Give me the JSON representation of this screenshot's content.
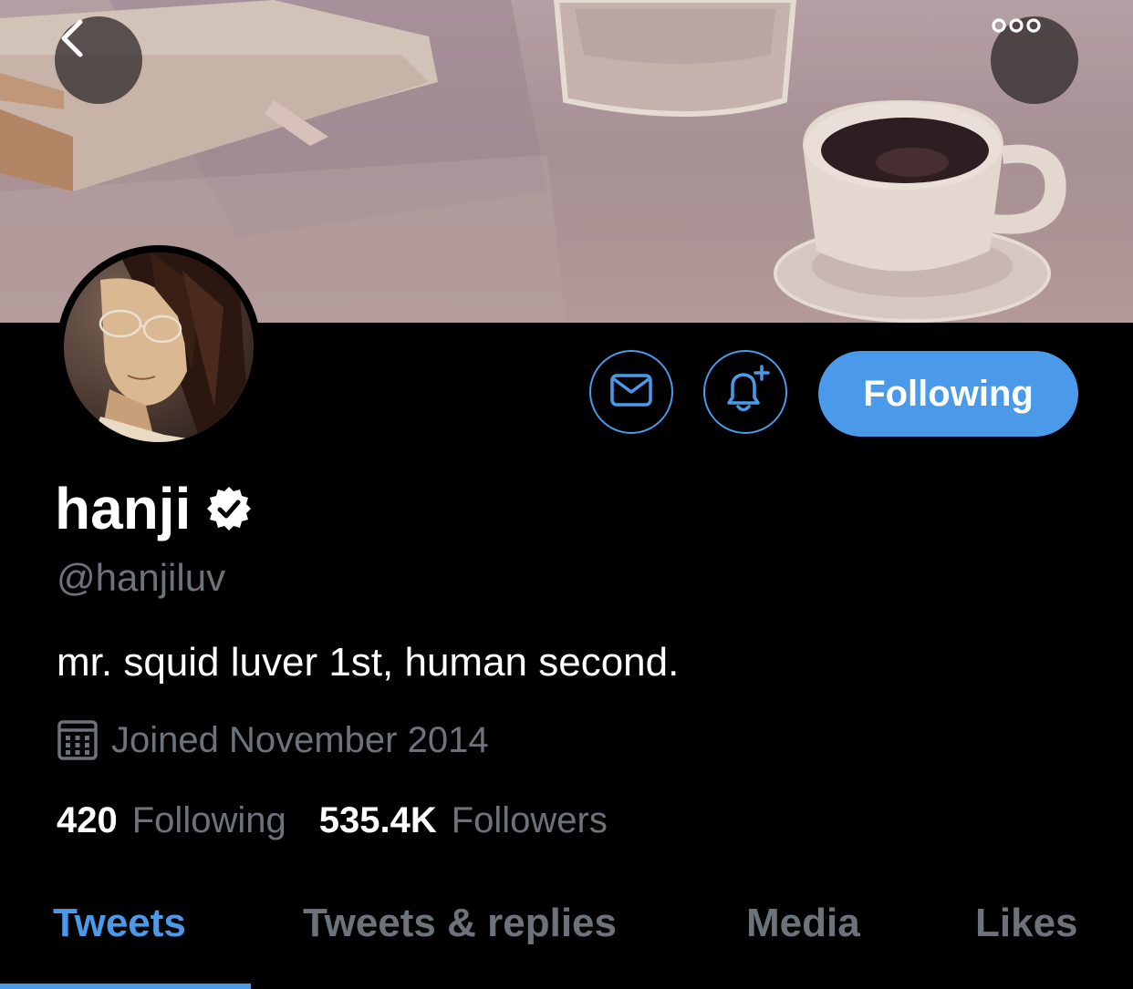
{
  "header": {
    "back_icon": "chevron-left-icon",
    "more_icon": "ellipsis-icon"
  },
  "profile": {
    "display_name": "hanji",
    "verified": true,
    "handle": "@hanjiluv",
    "bio": "mr. squid luver 1st, human second.",
    "joined": "Joined November 2014",
    "following_count": "420",
    "following_label": "Following",
    "followers_count": "535.4K",
    "followers_label": "Followers"
  },
  "actions": {
    "message_icon": "envelope-icon",
    "notify_icon": "bell-plus-icon",
    "following_button_label": "Following"
  },
  "tabs": [
    {
      "label": "Tweets",
      "active": true
    },
    {
      "label": "Tweets & replies",
      "active": false
    },
    {
      "label": "Media",
      "active": false
    },
    {
      "label": "Likes",
      "active": false
    }
  ],
  "colors": {
    "accent": "#4a9ae9",
    "secondary_text": "#6d737a",
    "background": "#000000"
  }
}
